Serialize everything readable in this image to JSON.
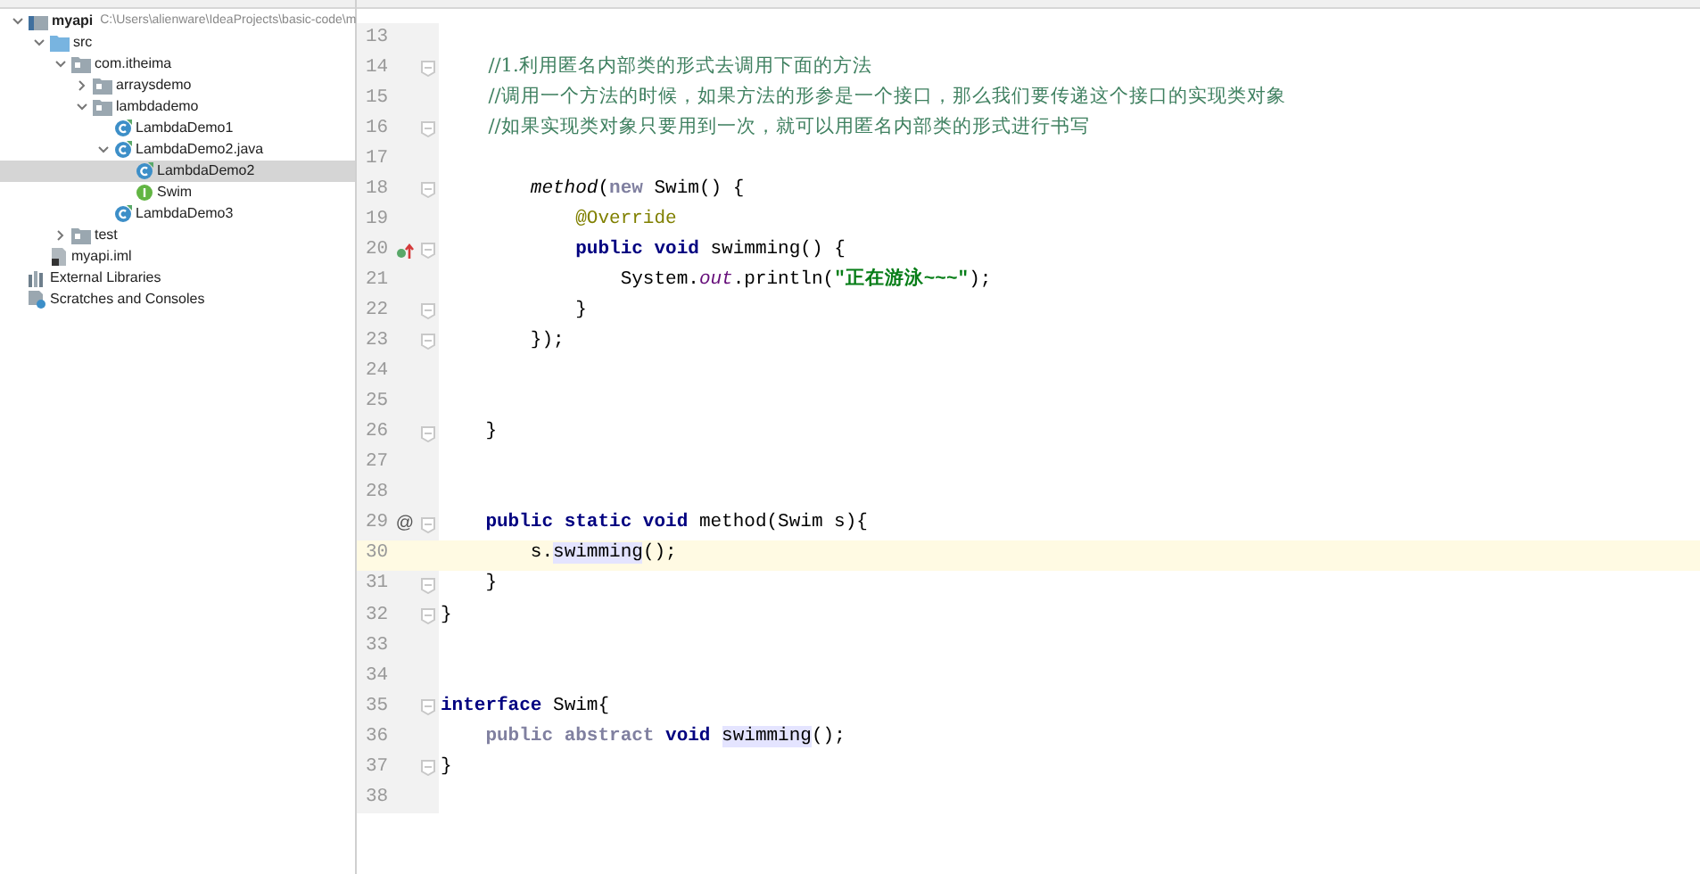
{
  "project_tree": [
    {
      "label": "myapi",
      "path": "C:\\Users\\alienware\\IdeaProjects\\basic-code\\m",
      "kind": "module",
      "expanded": true,
      "selected": false,
      "children": [
        {
          "label": "src",
          "kind": "source",
          "expanded": true,
          "selected": false,
          "children": [
            {
              "label": "com.itheima",
              "kind": "package",
              "expanded": true,
              "selected": false,
              "children": [
                {
                  "label": "arraysdemo",
                  "kind": "package",
                  "expanded": false,
                  "selected": false
                },
                {
                  "label": "lambdademo",
                  "kind": "package",
                  "expanded": true,
                  "selected": false,
                  "children": [
                    {
                      "label": "LambdaDemo1",
                      "kind": "class",
                      "selected": false
                    },
                    {
                      "label": "LambdaDemo2.java",
                      "kind": "class",
                      "expanded": true,
                      "selected": false,
                      "children": [
                        {
                          "label": "LambdaDemo2",
                          "kind": "class",
                          "selected": true
                        },
                        {
                          "label": "Swim",
                          "kind": "interface",
                          "selected": false
                        }
                      ]
                    },
                    {
                      "label": "LambdaDemo3",
                      "kind": "class",
                      "selected": false
                    }
                  ]
                }
              ]
            },
            {
              "label": "test",
              "kind": "package",
              "expanded": false,
              "selected": false
            }
          ]
        },
        {
          "label": "myapi.iml",
          "kind": "file",
          "selected": false
        }
      ]
    },
    {
      "label": "External Libraries",
      "kind": "libraries",
      "selected": false
    },
    {
      "label": "Scratches and Consoles",
      "kind": "scratches",
      "selected": false
    }
  ],
  "editor": {
    "lines": [
      {
        "number": "13",
        "current": false,
        "fold": false
      },
      {
        "number": "14",
        "current": false,
        "fold": true,
        "tokens": [
          {
            "kind": "comment",
            "text": "        //1.利用匿名内部类的形式去调用下面的方法"
          }
        ]
      },
      {
        "number": "15",
        "current": false,
        "fold": false,
        "tokens": [
          {
            "kind": "comment",
            "text": "        //调用一个方法的时候，如果方法的形参是一个接口，那么我们要传递这个接口的实现类对象"
          }
        ]
      },
      {
        "number": "16",
        "current": false,
        "fold": true,
        "tokens": [
          {
            "kind": "comment",
            "text": "        //如果实现类对象只要用到一次，就可以用匿名内部类的形式进行书写"
          }
        ]
      },
      {
        "number": "17",
        "current": false,
        "fold": false
      },
      {
        "number": "18",
        "current": false,
        "fold": true,
        "tokens": [
          {
            "kind": "method_call",
            "text": "        method"
          },
          {
            "kind": "plain",
            "text": "("
          },
          {
            "kind": "keyword_light",
            "text": "new"
          },
          {
            "kind": "plain",
            "text": " Swim() {"
          }
        ]
      },
      {
        "number": "19",
        "current": false,
        "fold": false,
        "tokens": [
          {
            "kind": "annotation",
            "text": "            @Override"
          }
        ]
      },
      {
        "number": "20",
        "current": false,
        "fold": true,
        "marker": {
          "kind": "override"
        },
        "tokens": [
          {
            "kind": "keyword",
            "text": "            public "
          },
          {
            "kind": "keyword",
            "text": "void"
          },
          {
            "kind": "plain",
            "text": " swimming() {"
          }
        ]
      },
      {
        "number": "21",
        "current": false,
        "fold": false,
        "tokens": [
          {
            "kind": "plain",
            "text": "                System."
          },
          {
            "kind": "field",
            "text": "out"
          },
          {
            "kind": "plain",
            "text": ".println("
          },
          {
            "kind": "string",
            "text": "\"正在游泳~~~\""
          },
          {
            "kind": "plain",
            "text": ");"
          }
        ]
      },
      {
        "number": "22",
        "current": false,
        "fold": true,
        "tokens": [
          {
            "kind": "plain",
            "text": "            }"
          }
        ]
      },
      {
        "number": "23",
        "current": false,
        "fold": true,
        "tokens": [
          {
            "kind": "plain",
            "text": "        });"
          }
        ]
      },
      {
        "number": "24",
        "current": false,
        "fold": false
      },
      {
        "number": "25",
        "current": false,
        "fold": false
      },
      {
        "number": "26",
        "current": false,
        "fold": true,
        "tokens": [
          {
            "kind": "plain",
            "text": "    }"
          }
        ]
      },
      {
        "number": "27",
        "current": false,
        "fold": false
      },
      {
        "number": "28",
        "current": false,
        "fold": false
      },
      {
        "number": "29",
        "current": false,
        "fold": true,
        "marker": {
          "kind": "text",
          "text": "@"
        },
        "tokens": [
          {
            "kind": "keyword",
            "text": "    public "
          },
          {
            "kind": "keyword",
            "text": "static "
          },
          {
            "kind": "keyword",
            "text": "void"
          },
          {
            "kind": "plain",
            "text": " method(Swim s){"
          }
        ]
      },
      {
        "number": "30",
        "current": true,
        "fold": false,
        "tokens": [
          {
            "kind": "plain",
            "text": "        s."
          },
          {
            "kind": "usage",
            "text": "swimming"
          },
          {
            "kind": "plain",
            "text": "();"
          }
        ]
      },
      {
        "number": "31",
        "current": false,
        "fold": true,
        "tokens": [
          {
            "kind": "plain",
            "text": "    }"
          }
        ]
      },
      {
        "number": "32",
        "current": false,
        "fold": true,
        "tokens": [
          {
            "kind": "plain",
            "text": "}"
          }
        ]
      },
      {
        "number": "33",
        "current": false,
        "fold": false
      },
      {
        "number": "34",
        "current": false,
        "fold": false
      },
      {
        "number": "35",
        "current": false,
        "fold": true,
        "tokens": [
          {
            "kind": "keyword",
            "text": "interface"
          },
          {
            "kind": "plain",
            "text": " Swim{"
          }
        ]
      },
      {
        "number": "36",
        "current": false,
        "fold": false,
        "tokens": [
          {
            "kind": "keyword_light",
            "text": "    public "
          },
          {
            "kind": "keyword_light",
            "text": "abstract "
          },
          {
            "kind": "keyword",
            "text": "void "
          },
          {
            "kind": "usage",
            "text": "swimming"
          },
          {
            "kind": "plain",
            "text": "();"
          }
        ]
      },
      {
        "number": "37",
        "current": false,
        "fold": true,
        "tokens": [
          {
            "kind": "plain",
            "text": "}"
          }
        ]
      },
      {
        "number": "38",
        "current": false,
        "fold": false
      }
    ]
  }
}
